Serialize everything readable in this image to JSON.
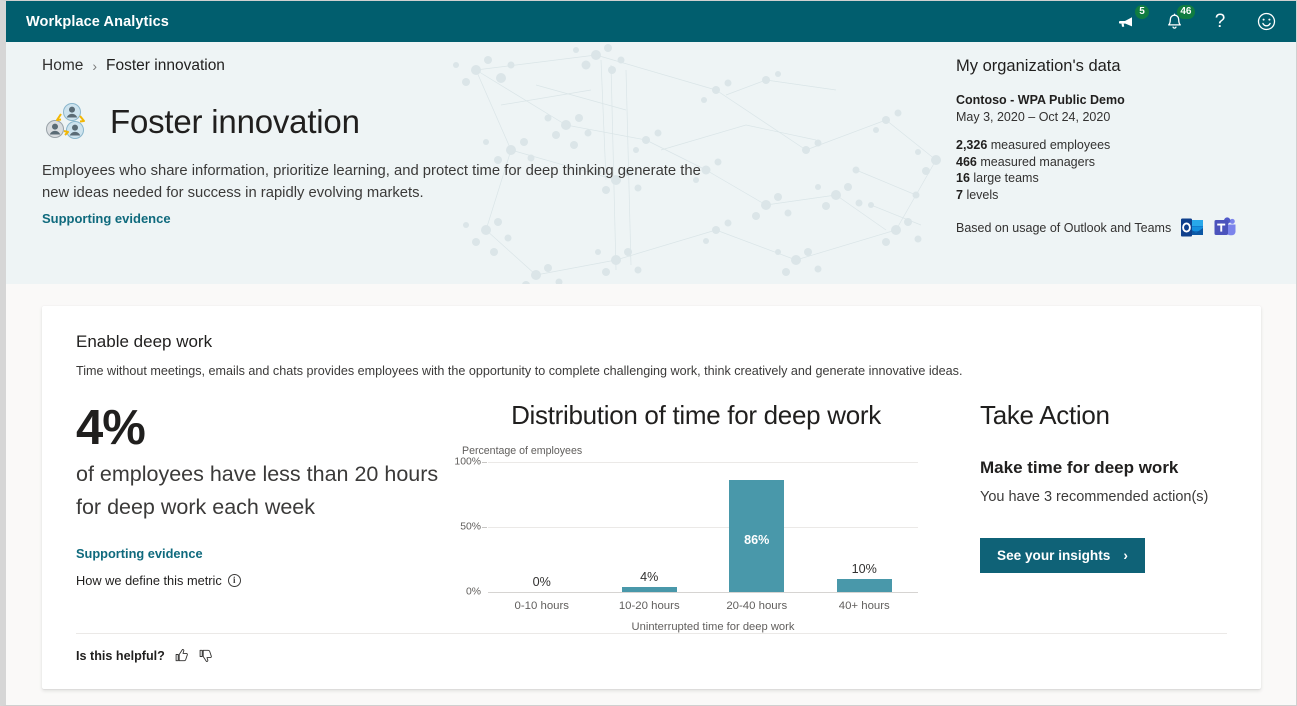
{
  "appbar": {
    "title": "Workplace Analytics",
    "announcements_badge": "5",
    "notifications_badge": "46",
    "help_glyph": "?",
    "icons": {
      "announcements": "megaphone-icon",
      "notifications": "bell-icon",
      "help": "help-icon",
      "feedback": "smiley-icon"
    }
  },
  "breadcrumb": {
    "home": "Home",
    "separator": "›",
    "current": "Foster innovation"
  },
  "hero": {
    "title": "Foster innovation",
    "description": "Employees who share information, prioritize learning, and protect time for deep thinking generate the new ideas needed for success in rapidly evolving markets.",
    "supporting_evidence": "Supporting evidence"
  },
  "org_panel": {
    "title": "My organization's data",
    "tenant": "Contoso - WPA Public Demo",
    "date_range": "May 3, 2020 – Oct 24, 2020",
    "stats": [
      {
        "value": "2,326",
        "label": "measured employees"
      },
      {
        "value": "466",
        "label": "measured managers"
      },
      {
        "value": "16",
        "label": "large teams"
      },
      {
        "value": "7",
        "label": "levels"
      }
    ],
    "based_on": "Based on usage of Outlook and Teams"
  },
  "card": {
    "title": "Enable deep work",
    "subtitle": "Time without meetings, emails and chats provides employees with the opportunity to complete challenging work, think creatively and generate innovative ideas.",
    "stat": {
      "big_number": "4%",
      "description": "of employees have less than 20 hours for deep work each week",
      "supporting_evidence": "Supporting evidence",
      "define_metric": "How we define this metric"
    },
    "action": {
      "title": "Take Action",
      "subtitle": "Make time for deep work",
      "description": "You have 3 recommended action(s)",
      "button_label": "See your insights",
      "button_chevron": "›"
    },
    "footer": {
      "helpful_label": "Is this helpful?",
      "thumbs_up": "thumbs-up-icon",
      "thumbs_down": "thumbs-down-icon"
    }
  },
  "chart_data": {
    "type": "bar",
    "title": "Distribution of time for deep work",
    "ylabel": "Percentage of employees",
    "xlabel": "Uninterrupted time for deep work",
    "categories": [
      "0-10 hours",
      "10-20 hours",
      "20-40 hours",
      "40+ hours"
    ],
    "values": [
      0,
      4,
      86,
      10
    ],
    "value_labels": [
      "0%",
      "4%",
      "86%",
      "10%"
    ],
    "yticks": [
      "0%",
      "50%",
      "100%"
    ],
    "ytick_values": [
      0,
      50,
      100
    ],
    "ylim": [
      0,
      100
    ],
    "grid": true,
    "legend": "none",
    "bar_color": "#4998aa"
  },
  "colors": {
    "appbar": "#015e6e",
    "hero_bg": "#eef4f5",
    "page_bg": "#faf9f8",
    "accent_link": "#0f6a7d",
    "button": "#0f6277",
    "badge": "#107c41",
    "bar": "#4998aa"
  }
}
